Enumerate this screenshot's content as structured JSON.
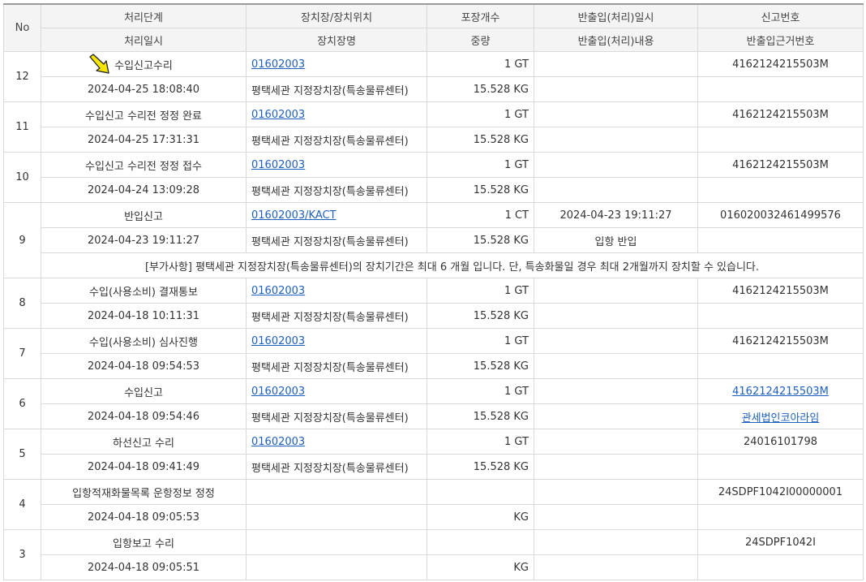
{
  "headers": {
    "no": "No",
    "row1": [
      "처리단계",
      "장치장/장치위치",
      "포장개수",
      "반출입(처리)일시",
      "신고번호"
    ],
    "row2": [
      "처리일시",
      "장치장명",
      "중량",
      "반출입(처리)내용",
      "반출입근거번호"
    ]
  },
  "rows": [
    {
      "no": "12",
      "stage": "수입신고수리",
      "datetime": "2024-04-25 18:08:40",
      "location_code": "01602003",
      "location_name": "평택세관 지정장치장(특송물류센터)",
      "count": "1 GT",
      "weight": "15.528 KG",
      "io_datetime": "",
      "io_content": "",
      "declaration_no": "4162124215503M",
      "basis_no": ""
    },
    {
      "no": "11",
      "stage": "수입신고 수리전 정정 완료",
      "datetime": "2024-04-25 17:31:31",
      "location_code": "01602003",
      "location_name": "평택세관 지정장치장(특송물류센터)",
      "count": "1 GT",
      "weight": "15.528 KG",
      "io_datetime": "",
      "io_content": "",
      "declaration_no": "4162124215503M",
      "basis_no": ""
    },
    {
      "no": "10",
      "stage": "수입신고 수리전 정정 접수",
      "datetime": "2024-04-24 13:09:28",
      "location_code": "01602003",
      "location_name": "평택세관 지정장치장(특송물류센터)",
      "count": "1 GT",
      "weight": "15.528 KG",
      "io_datetime": "",
      "io_content": "",
      "declaration_no": "4162124215503M",
      "basis_no": ""
    },
    {
      "no": "9",
      "stage": "반입신고",
      "datetime": "2024-04-23 19:11:27",
      "location_code": "01602003/KACT",
      "location_name": "평택세관 지정장치장(특송물류센터)",
      "count": "1 CT",
      "weight": "15.528 KG",
      "io_datetime": "2024-04-23 19:11:27",
      "io_content": "입항 반입",
      "declaration_no": "016020032461499576",
      "basis_no": "",
      "note": "[부가사항] 평택세관 지정장치장(특송물류센터)의 장치기간은 최대 6 개월 입니다. 단, 특송화물일 경우 최대 2개월까지 장치할 수 있습니다."
    },
    {
      "no": "8",
      "stage": "수입(사용소비) 결재통보",
      "datetime": "2024-04-18 10:11:31",
      "location_code": "01602003",
      "location_name": "평택세관 지정장치장(특송물류센터)",
      "count": "1 GT",
      "weight": "15.528 KG",
      "io_datetime": "",
      "io_content": "",
      "declaration_no": "4162124215503M",
      "basis_no": ""
    },
    {
      "no": "7",
      "stage": "수입(사용소비) 심사진행",
      "datetime": "2024-04-18 09:54:53",
      "location_code": "01602003",
      "location_name": "평택세관 지정장치장(특송물류센터)",
      "count": "1 GT",
      "weight": "15.528 KG",
      "io_datetime": "",
      "io_content": "",
      "declaration_no": "4162124215503M",
      "basis_no": ""
    },
    {
      "no": "6",
      "stage": "수입신고",
      "datetime": "2024-04-18 09:54:46",
      "location_code": "01602003",
      "location_name": "평택세관 지정장치장(특송물류센터)",
      "count": "1 GT",
      "weight": "15.528 KG",
      "io_datetime": "",
      "io_content": "",
      "declaration_no": "4162124215503M",
      "basis_no": "관세법인코아라임",
      "links": true
    },
    {
      "no": "5",
      "stage": "하선신고 수리",
      "datetime": "2024-04-18 09:41:49",
      "location_code": "01602003",
      "location_name": "평택세관 지정장치장(특송물류센터)",
      "count": "1 GT",
      "weight": "15.528 KG",
      "io_datetime": "",
      "io_content": "",
      "declaration_no": "24016101798",
      "basis_no": ""
    },
    {
      "no": "4",
      "stage": "입항적재화물목록 운항정보 정정",
      "datetime": "2024-04-18 09:05:53",
      "location_code": "",
      "location_name": "",
      "count": "",
      "weight": "KG",
      "io_datetime": "",
      "io_content": "",
      "declaration_no": "24SDPF1042I00000001",
      "basis_no": ""
    },
    {
      "no": "3",
      "stage": "입항보고 수리",
      "datetime": "2024-04-18 09:05:51",
      "location_code": "",
      "location_name": "",
      "count": "",
      "weight": "KG",
      "io_datetime": "",
      "io_content": "",
      "declaration_no": "24SDPF1042I",
      "basis_no": ""
    }
  ],
  "colors": {
    "header_bg": "#f4f4f4",
    "border": "#d9d9d9",
    "link": "#1f5fbf",
    "arrow": "#f5e500"
  },
  "icons": {
    "pointer": "yellow-arrow-icon"
  }
}
